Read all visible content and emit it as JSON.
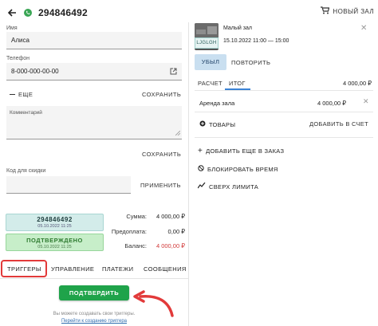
{
  "header": {
    "order_number": "294846492",
    "new_hall_label": "НОВЫЙ ЗАЛ"
  },
  "form": {
    "name_label": "Имя",
    "name_value": "Алиса",
    "phone_label": "Телефон",
    "phone_value": "8-000-000-00-00",
    "more_label": "ЕЩЕ",
    "save_label": "СОХРАНИТЬ",
    "comment_label": "Комментарий",
    "save2_label": "СОХРАНИТЬ",
    "discount_label": "Код для скидки",
    "apply_label": "ПРИМЕНИТЬ"
  },
  "status": {
    "order_badge": "294846492",
    "order_badge_date": "05.10.2022 11:25",
    "confirmed_badge": "ПОДТВЕРЖДЕНО",
    "confirmed_date": "05.10.2022 11:25"
  },
  "totals": {
    "sum_label": "Сумма:",
    "sum_value": "4 000,00 ₽",
    "prepay_label": "Предоплата:",
    "prepay_value": "0,00 ₽",
    "balance_label": "Баланс:",
    "balance_value": "4 000,00 ₽"
  },
  "tabs": [
    "ТРИГГЕРЫ",
    "УПРАВЛЕНИЕ",
    "ПЛАТЕЖИ",
    "СООБЩЕНИЯ"
  ],
  "confirm_button": "ПОДТВЕРДИТЬ",
  "hint": {
    "text": "Вы можете создавать свои триггеры.",
    "link": "Перейти к созданию триггера"
  },
  "booking": {
    "thumb_tag": "LJGLGH",
    "hall_name": "Малый зал",
    "time": "15.10.2022 11:00 — 15:00",
    "left_button": "УБЫЛ",
    "repeat_button": "ПОВТОРИТЬ"
  },
  "calc": {
    "tab_calc": "РАСЧЕТ",
    "tab_total": "ИТОГ",
    "total_value": "4 000,00 ₽",
    "rent_label": "Аренда зала",
    "rent_value": "4 000,00 ₽",
    "goods_label": "ТОВАРЫ",
    "add_bill_label": "ДОБАВИТЬ В СЧЕТ"
  },
  "actions": [
    "ДОБАВИТЬ ЕЩЕ В ЗАКАЗ",
    "БЛОКИРОВАТЬ ВРЕМЯ",
    "СВЕРХ ЛИМИТА"
  ],
  "colors": {
    "accent_green": "#1fa34a",
    "highlight_red": "#e23a3a",
    "balance_red": "#d23a3a",
    "tab_blue": "#3a83d6"
  }
}
